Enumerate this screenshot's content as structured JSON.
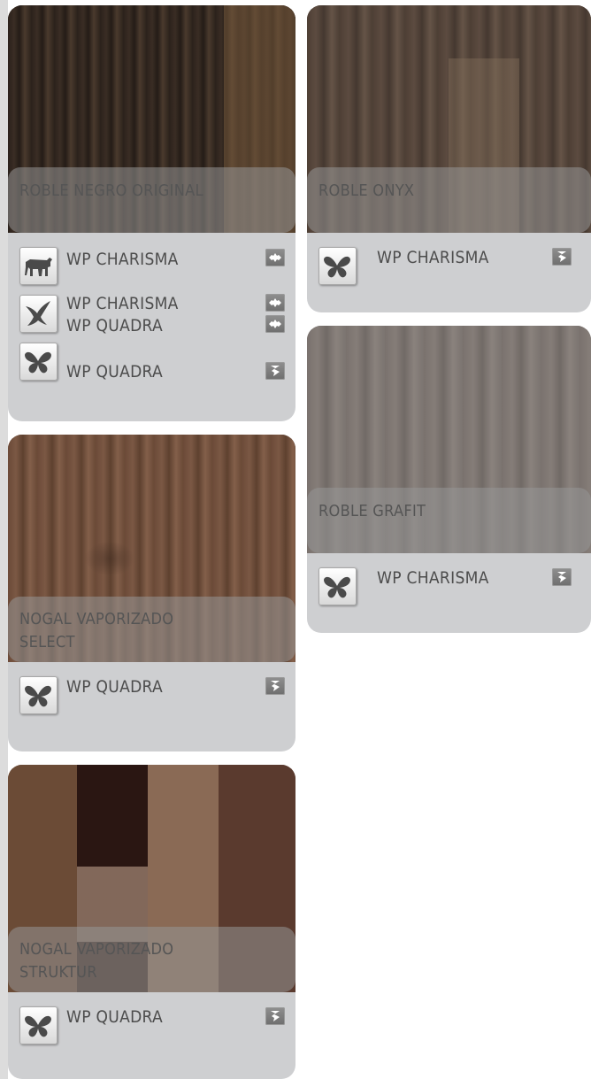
{
  "products": {
    "roble_negro": {
      "name": "ROBLE NEGRO ORIGINAL",
      "items": [
        {
          "label": "WP CHARISMA",
          "icon": "bull-icon"
        },
        {
          "label": "WP CHARISMA",
          "icon": "eagle-icon"
        },
        {
          "label": "WP QUADRA",
          "icon": "eagle-icon"
        },
        {
          "label": "WP QUADRA",
          "icon": "butterfly-icon"
        }
      ]
    },
    "nogal_select": {
      "name": "NOGAL VAPORIZADO\nSELECT",
      "items": [
        {
          "label": "WP QUADRA",
          "icon": "butterfly-icon"
        }
      ]
    },
    "nogal_struktur": {
      "name": "NOGAL VAPORIZADO\nSTRUKTUR",
      "items": [
        {
          "label": "WP QUADRA",
          "icon": "butterfly-icon"
        }
      ]
    },
    "roble_onyx": {
      "name": "ROBLE ONYX",
      "items": [
        {
          "label": "WP CHARISMA",
          "icon": "butterfly-icon"
        }
      ]
    },
    "roble_grafit": {
      "name": "ROBLE GRAFIT",
      "items": [
        {
          "label": "WP CHARISMA",
          "icon": "butterfly-icon"
        }
      ]
    }
  },
  "colors": {
    "card_bg": "#cecfd1",
    "caption_text": "#555555",
    "label_text": "#4c4c4c",
    "badge_bg": "#7f7f7f"
  }
}
